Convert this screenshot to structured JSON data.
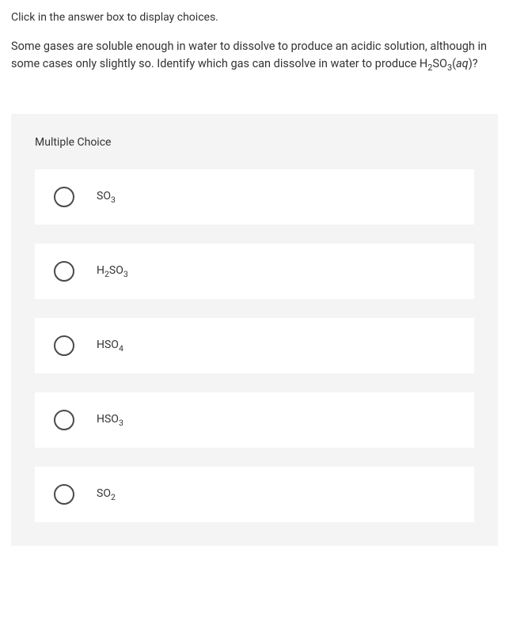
{
  "instruction": "Click in the answer box to display choices.",
  "question": {
    "prefix": "Some gases are soluble enough in water to dissolve to produce an acidic solution, although in some cases only slightly so. Identify which gas can dissolve in water to produce H",
    "sub1": "2",
    "mid1": "SO",
    "sub2": "3",
    "suffix": "(",
    "aq": "aq",
    "end": ")?"
  },
  "quiz_header": "Multiple Choice",
  "options": [
    {
      "base1": "SO",
      "sub1": "3",
      "base2": "",
      "sub2": ""
    },
    {
      "base1": "H",
      "sub1": "2",
      "base2": "SO",
      "sub2": "3"
    },
    {
      "base1": "HSO",
      "sub1": "4",
      "base2": "",
      "sub2": ""
    },
    {
      "base1": "HSO",
      "sub1": "3",
      "base2": "",
      "sub2": ""
    },
    {
      "base1": "SO",
      "sub1": "2",
      "base2": "",
      "sub2": ""
    }
  ]
}
